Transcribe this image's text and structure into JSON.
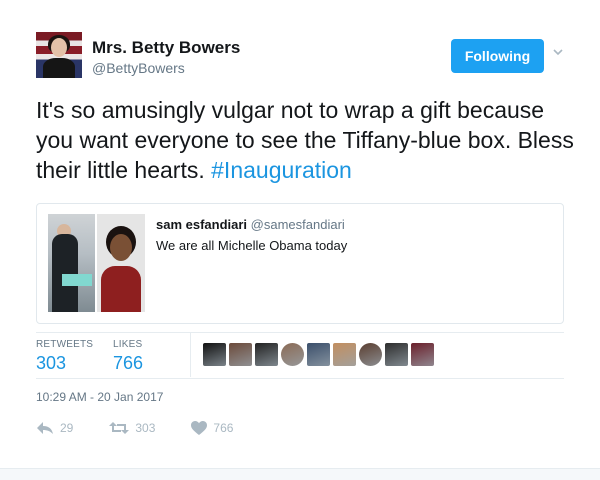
{
  "author": {
    "name": "Mrs. Betty Bowers",
    "handle": "@BettyBowers",
    "avatar_icon": "profile-photo-avatar"
  },
  "follow_button": {
    "label": "Following",
    "color": "#1da1f2"
  },
  "tweet": {
    "text": "It's so amusingly vulgar not to wrap a gift because you want everyone to see the Tiffany-blue box. Bless their little hearts. ",
    "hashtag": "#Inauguration",
    "hashtag_color": "#1b95e0"
  },
  "quoted_tweet": {
    "name": "sam esfandiari",
    "handle": "@samesfandiari",
    "text": "We are all Michelle Obama today"
  },
  "stats": {
    "retweets_label": "RETWEETS",
    "retweets_value": "303",
    "likes_label": "LIKES",
    "likes_value": "766"
  },
  "likers": [
    {
      "name": "liker-1",
      "color": "#111111"
    },
    {
      "name": "liker-2",
      "color": "#6b4a3a"
    },
    {
      "name": "liker-3",
      "color": "#222222"
    },
    {
      "name": "liker-4",
      "color": "#8a6a55"
    },
    {
      "name": "liker-5",
      "color": "#3b4f6b"
    },
    {
      "name": "liker-6",
      "color": "#c28e5f"
    },
    {
      "name": "liker-7",
      "color": "#5a3e30"
    },
    {
      "name": "liker-8",
      "color": "#2d2d2d"
    },
    {
      "name": "liker-9",
      "color": "#6a1f2a"
    }
  ],
  "timestamp": "10:29 AM - 20 Jan 2017",
  "actions": {
    "reply_count": "29",
    "retweet_count": "303",
    "like_count": "766"
  }
}
